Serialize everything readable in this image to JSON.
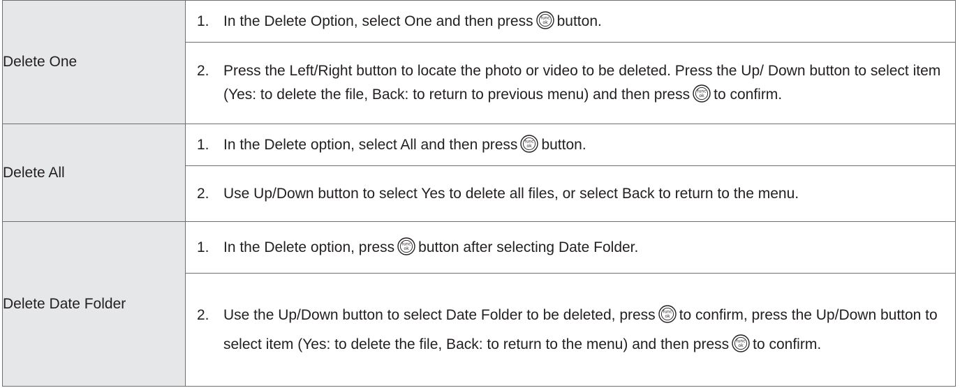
{
  "rows": [
    {
      "label": "Delete One",
      "steps": [
        {
          "number": "1.",
          "text_a": "In the Delete Option, select One and then press",
          "text_b": "button."
        },
        {
          "number": "2.",
          "text_a": "Press the Left/Right button to locate the photo or video to be deleted. Press the Up/ Down button to select item (Yes: to delete the file, Back: to return to previous menu) and then press",
          "text_b": "to confirm."
        }
      ]
    },
    {
      "label": "Delete All",
      "steps": [
        {
          "number": "1.",
          "text_a": "In the Delete option, select All and then press",
          "text_b": "button."
        },
        {
          "number": "2.",
          "text": "Use Up/Down button to select Yes to delete all files, or select Back to return to the menu."
        }
      ]
    },
    {
      "label": "Delete Date Folder",
      "steps": [
        {
          "number": "1.",
          "text_a": "In the Delete option, press",
          "text_b": "button after selecting Date Folder."
        },
        {
          "number": "2.",
          "text_a": "Use the Up/Down button to select Date Folder to be deleted, press",
          "text_b": "to confirm, press the Up/Down button to select item (Yes: to delete the file, Back: to return to the menu) and then press",
          "text_c": "to confirm."
        }
      ]
    }
  ],
  "icon": {
    "name": "func-ok-button-icon",
    "top_text": "func",
    "bottom_text": "ok"
  },
  "colors": {
    "label_background": "#e6e7e8",
    "border": "#6d6e71",
    "text": "#231f20"
  }
}
